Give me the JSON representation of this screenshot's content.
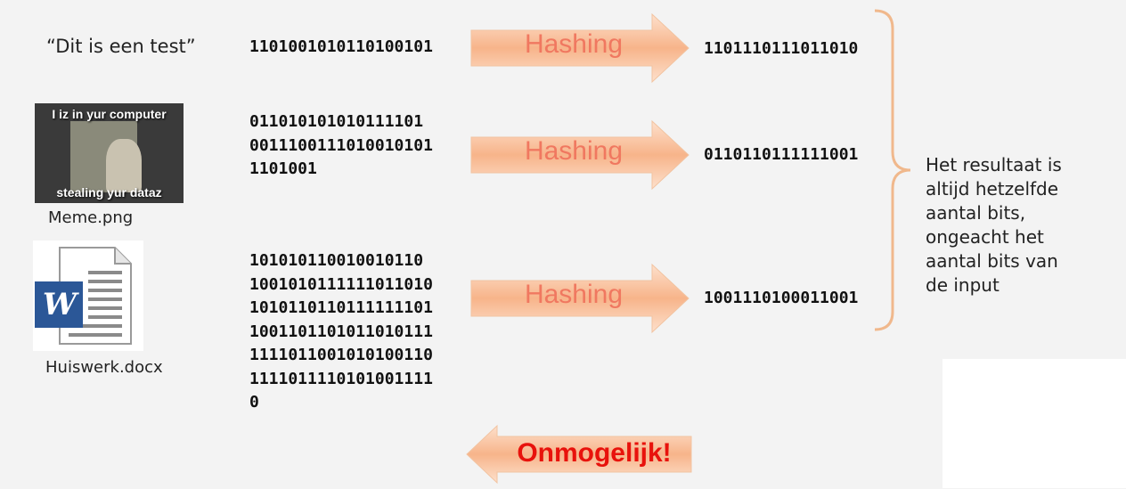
{
  "rows": [
    {
      "input_label": "“Dit is een test”",
      "input_bits": "1101001010110100101",
      "action": "Hashing",
      "hash": "1101110111011010"
    },
    {
      "input_label": "Meme.png",
      "meme_top_text": "I iz in yur computer",
      "meme_bottom_text": "stealing yur dataz",
      "input_bits": "011010101010111101\n0011100111010010101\n1101001",
      "action": "Hashing",
      "hash": "0110110111111001"
    },
    {
      "input_label": "Huiswerk.docx",
      "word_letter": "W",
      "input_bits": "101010110010010110\n1001010111111011010\n1010110110111111101\n1001101101011010111\n1111011001010100110\n1111011110101001111\n0",
      "action": "Hashing",
      "hash": "1001110100011001"
    }
  ],
  "brace_text": "Het resultaat is\naltijd hetzelfde\naantal bits,\nongeacht het\naantal bits van\nde input",
  "reverse_label": "Onmogelijk!",
  "colors": {
    "arrow_fill_light": "#fde0cc",
    "arrow_fill_dark": "#f7b48a",
    "arrow_text": "#f07860",
    "reverse_text": "#e8120c",
    "brace": "#f0b88c",
    "word_blue": "#2b5797"
  }
}
